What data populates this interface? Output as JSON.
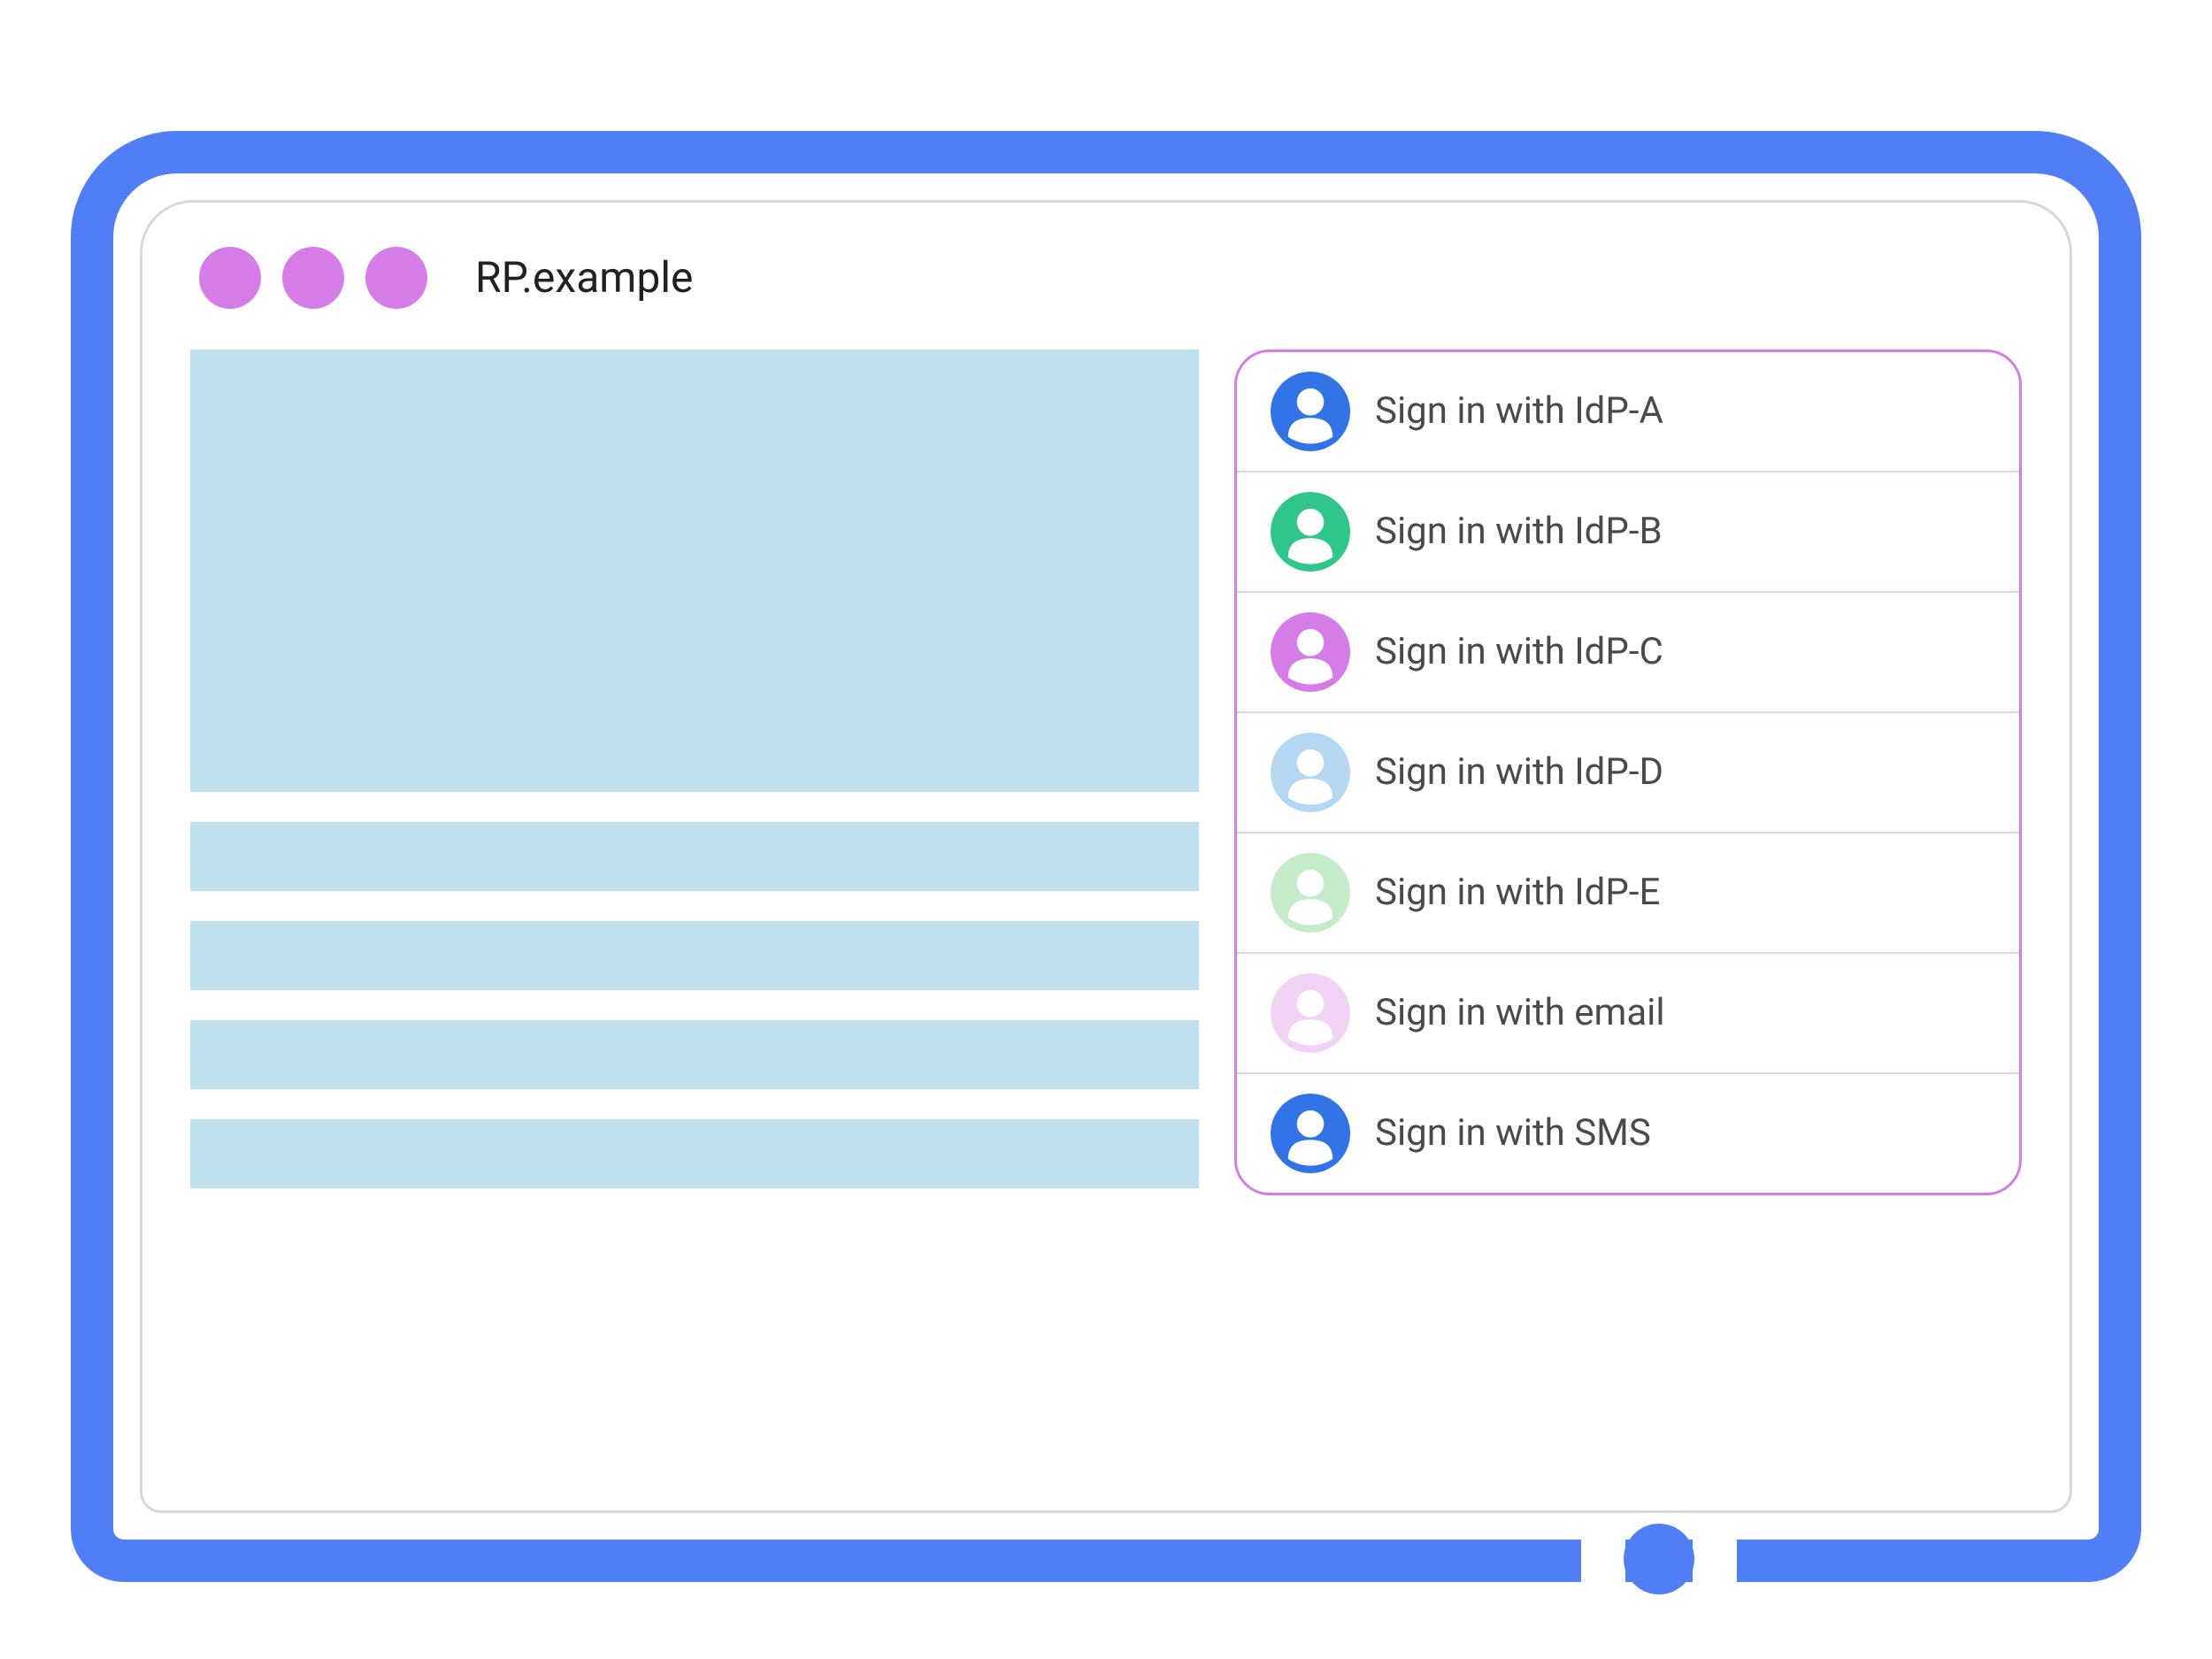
{
  "browser": {
    "address": "RP.example"
  },
  "content": {
    "heroBlocks": 1,
    "lineBlocks": 4
  },
  "signin": {
    "options": [
      {
        "label": "Sign in with IdP-A",
        "color": "#3273e8"
      },
      {
        "label": "Sign in with IdP-B",
        "color": "#2ec789"
      },
      {
        "label": "Sign in with IdP-C",
        "color": "#d67ce8"
      },
      {
        "label": "Sign in with IdP-D",
        "color": "#b4d7f4"
      },
      {
        "label": "Sign in with IdP-E",
        "color": "#c4ecc9"
      },
      {
        "label": "Sign in with email",
        "color": "#f1d4f5"
      },
      {
        "label": "Sign in with SMS",
        "color": "#3273e8"
      }
    ]
  },
  "colors": {
    "frame": "#4f7ef7",
    "trafficLight": "#d67ce8",
    "contentBlock": "#bde0ef",
    "panelBorder": "#d67ce8",
    "panelDivider": "#efc9f5"
  }
}
